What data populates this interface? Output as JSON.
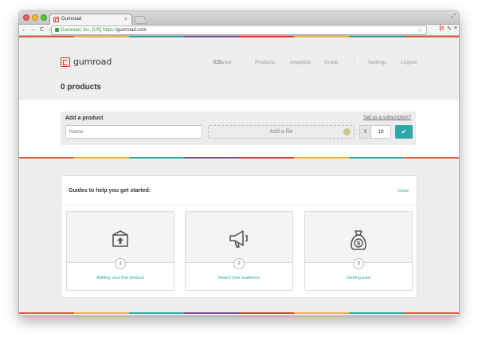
{
  "browser": {
    "tab_title": "Gumroad",
    "tab_close": "×",
    "address": {
      "org": "Gumroad, Inc. [US]",
      "scheme": "https://",
      "host": "gumroad.com"
    }
  },
  "header": {
    "logo_text": "gumroad",
    "nav": [
      {
        "label": "Balance"
      },
      {
        "label": "Products"
      },
      {
        "label": "Analytics"
      },
      {
        "label": "Guide"
      },
      {
        "label": "Settings"
      },
      {
        "label": "Logout"
      }
    ],
    "page_title": "0 products"
  },
  "add_product": {
    "title": "Add a product",
    "sell_subscription_link": "Sell as a subscription?",
    "name_placeholder": "Name",
    "file_label": "Add a file",
    "currency": "$",
    "price": "19",
    "submit_icon": "✔"
  },
  "guides": {
    "title": "Guides to help you get started:",
    "close_label": "Close",
    "items": [
      {
        "number": "1",
        "label": "Adding your first product",
        "icon": "box-upload-icon"
      },
      {
        "number": "2",
        "label": "Reach your audience",
        "icon": "megaphone-icon"
      },
      {
        "number": "3",
        "label": "Getting paid",
        "icon": "money-bag-icon"
      }
    ]
  },
  "colors": {
    "accent": "#2ea7a9",
    "brand_red": "#e0362c",
    "stripe": [
      "#e25a3c",
      "#f0b23a",
      "#2ea7a9",
      "#7b4f9d",
      "#d9402d",
      "#f0b23a",
      "#2ea7a9",
      "#e25a3c"
    ]
  }
}
